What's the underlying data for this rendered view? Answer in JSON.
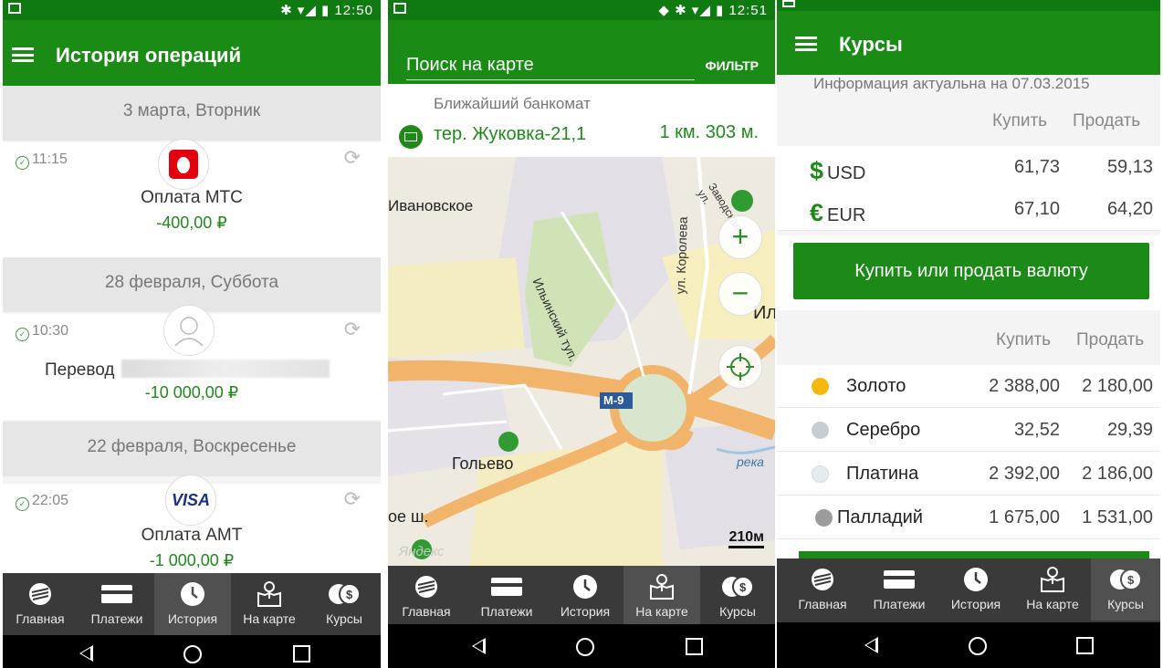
{
  "status_bar": {
    "time_1": "12:50",
    "time_2": "12:51"
  },
  "history": {
    "title": "История операций",
    "groups": [
      {
        "date": "3 марта, Вторник",
        "time": "11:15",
        "title": "Оплата МТС",
        "amount": "-400,00 ₽",
        "logo": "mts-logo-icon"
      },
      {
        "date": "28 февраля, Суббота",
        "time": "10:30",
        "title": "Перевод",
        "amount": "-10 000,00 ₽",
        "logo": "person-avatar-icon"
      },
      {
        "date": "22 февраля, Воскресенье",
        "time": "22:05",
        "title": "Оплата АМТ",
        "amount": "-1 000,00 ₽",
        "logo": "visa-logo-icon",
        "logo_text": "VISA"
      }
    ]
  },
  "map_screen": {
    "search_placeholder": "Поиск на карте",
    "filter_label": "ФИЛЬТР",
    "nearest_caption": "Ближайший банкомат",
    "atm_name": "тер. Жуковка-21,1",
    "atm_distance": "1 км. 303 м.",
    "labels": {
      "village1": "Ивановское",
      "village2": "Гольево",
      "street1": "Ильинский туп.",
      "street2": "ул. Королева",
      "road": "М-9",
      "river": "река",
      "scale": "210м",
      "yandex": "Яндекс",
      "highway_frag": "ое ш.",
      "road_frag": "Ил",
      "street3": "Заводская ул."
    }
  },
  "rates": {
    "title": "Курсы",
    "info": "Информация актуальна на 07.03.2015",
    "buy_label": "Купить",
    "sell_label": "Продать",
    "currencies": [
      {
        "symbol": "$",
        "code": "USD",
        "buy": "61,73",
        "sell": "59,13"
      },
      {
        "symbol": "€",
        "code": "EUR",
        "buy": "67,10",
        "sell": "64,20"
      }
    ],
    "action_button": "Купить или продать валюту",
    "metals": [
      {
        "name": "Золото",
        "buy": "2 388,00",
        "sell": "2 180,00",
        "color": "#f5b80f"
      },
      {
        "name": "Серебро",
        "buy": "32,52",
        "sell": "29,39",
        "color": "#c7cdd0"
      },
      {
        "name": "Платина",
        "buy": "2 392,00",
        "sell": "2 186,00",
        "color": "#e6ebee"
      },
      {
        "name": "Палладий",
        "buy": "1 675,00",
        "sell": "1 531,00",
        "color": "#9c9c9c"
      }
    ]
  },
  "nav": {
    "items": [
      "Главная",
      "Платежи",
      "История",
      "На карте",
      "Курсы"
    ]
  },
  "colors": {
    "brand_green": "#1a8c16",
    "nav_bg": "#3a3a3a"
  }
}
